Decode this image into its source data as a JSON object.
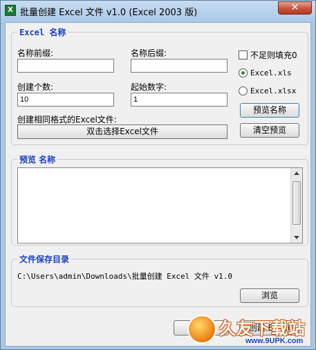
{
  "window": {
    "title": "批量创建 Excel 文件 v1.0 (Excel 2003 版)",
    "app_icon": "X",
    "close_glyph": "✕"
  },
  "name_group": {
    "legend": "Excel 名称",
    "prefix_label": "名称前缀:",
    "prefix_value": "",
    "suffix_label": "名称后缀:",
    "suffix_value": "",
    "count_label": "创建个数:",
    "count_value": "10",
    "start_label": "起始数字:",
    "start_value": "1",
    "template_label": "创建相同格式的Excel文件:",
    "template_button": "双击选择Excel文件",
    "pad_zero_label": "不足则填充0",
    "pad_zero_checked": false,
    "xls_label": "Excel.xls",
    "xlsx_label": "Excel.xlsx",
    "selected_format": "xls",
    "preview_button": "预览名称",
    "clear_button": "清空预览"
  },
  "preview_group": {
    "legend": "预览 名称",
    "content": ""
  },
  "save_group": {
    "legend": "文件保存目录",
    "path": "C:\\Users\\admin\\Downloads\\批量创建 Excel 文件 v1.0",
    "browse_button": "浏览"
  },
  "bottom_buttons": {
    "left_visible": "帮",
    "right_visible": "创建 Excel"
  },
  "watermark": {
    "title": "久友下载站",
    "url": "www.9UPK.com"
  },
  "colors": {
    "legend": "#1a3fc4",
    "titlebar": "#aac7e6",
    "close": "#c7533c"
  }
}
